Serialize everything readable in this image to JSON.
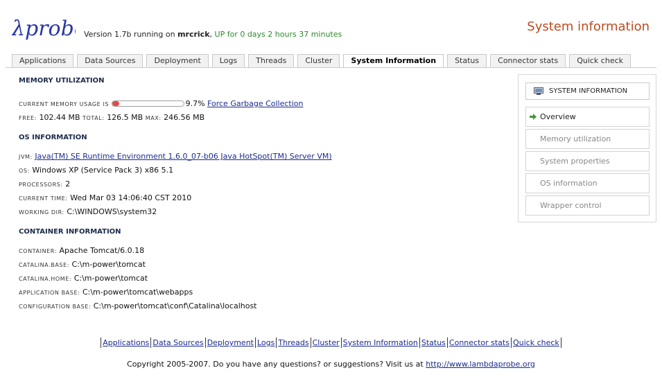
{
  "header": {
    "logo_text": "λprobe",
    "version_prefix": "Version 1.7b running on",
    "host": "mrcrick",
    "uptime": "UP for 0 days 2 hours 37 minutes",
    "page_title": "System information",
    "brand_color": "#c04a1e"
  },
  "tabs": [
    {
      "label": "Applications"
    },
    {
      "label": "Data Sources"
    },
    {
      "label": "Deployment"
    },
    {
      "label": "Logs"
    },
    {
      "label": "Threads"
    },
    {
      "label": "Cluster"
    },
    {
      "label": "System Information",
      "active": true
    },
    {
      "label": "Status"
    },
    {
      "label": "Connector stats"
    },
    {
      "label": "Quick check"
    }
  ],
  "memory": {
    "heading": "MEMORY UTILIZATION",
    "usage_label": "CURRENT MEMORY USAGE IS",
    "usage_percent": "9.7%",
    "usage_fraction": 0.097,
    "gc_link": "Force Garbage Collection",
    "free_label": "FREE:",
    "free_value": "102.44 MB",
    "total_label": "TOTAL:",
    "total_value": "126.5 MB",
    "max_label": "MAX:",
    "max_value": "246.56 MB"
  },
  "os": {
    "heading": "OS INFORMATION",
    "jvm_label": "JVM:",
    "jvm_value": " Java(TM) SE Runtime Environment  1.6.0_07-b06  Java HotSpot(TM) Server VM)",
    "os_label": "OS:",
    "os_value": "Windows XP (Service Pack 3) x86 5.1",
    "processors_label": "PROCESSORS:",
    "processors_value": "2",
    "time_label": "CURRENT TIME:",
    "time_value": "Wed Mar 03 14:06:40 CST 2010",
    "workdir_label": "WORKING DIR:",
    "workdir_value": "C:\\WINDOWS\\system32"
  },
  "container": {
    "heading": "CONTAINER INFORMATION",
    "container_label": "CONTAINER:",
    "container_value": "Apache Tomcat/6.0.18",
    "base_label": "CATALINA.BASE:",
    "base_value": "C:\\m-power\\tomcat",
    "home_label": "CATALINA.HOME:",
    "home_value": "C:\\m-power\\tomcat",
    "appbase_label": "APPLICATION BASE:",
    "appbase_value": "C:\\m-power\\tomcat\\webapps",
    "confbase_label": "CONFIGURATION BASE:",
    "confbase_value": "C:\\m-power\\tomcat\\conf\\Catalina\\localhost"
  },
  "sidebar": {
    "header": "SYSTEM INFORMATION",
    "header_icon": "computer-icon",
    "items": [
      {
        "label": "Overview",
        "active": true,
        "icon": "arrow-right-icon"
      },
      {
        "label": "Memory utilization"
      },
      {
        "label": "System properties"
      },
      {
        "label": "OS information"
      },
      {
        "label": "Wrapper control"
      }
    ]
  },
  "footer": {
    "links": [
      "Applications",
      "Data Sources",
      "Deployment",
      "Logs",
      "Threads",
      "Cluster",
      "System Information",
      "Status",
      "Connector stats",
      "Quick check"
    ],
    "copyright_text": "Copyright 2005-2007. Do you have any questions? or suggestions? Visit us at",
    "copyright_link": "http://www.lambdaprobe.org"
  }
}
